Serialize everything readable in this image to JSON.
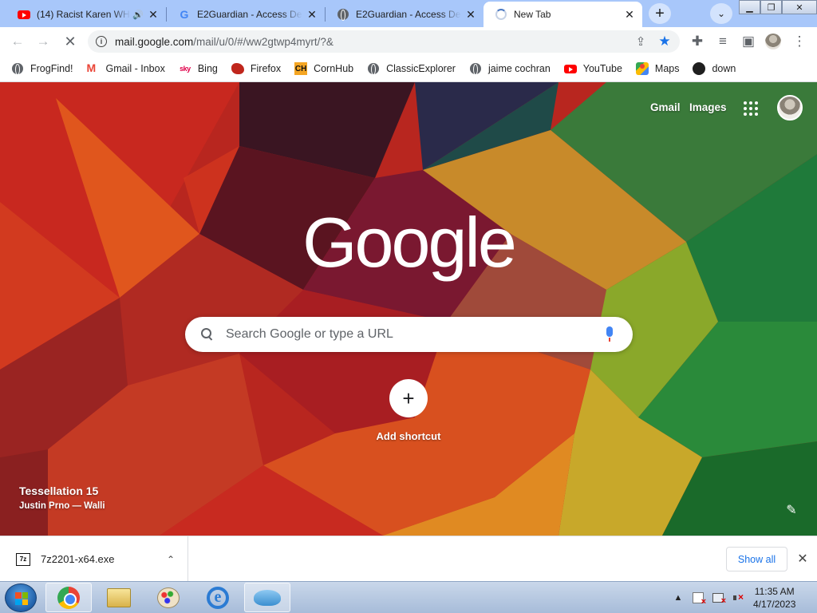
{
  "browser": {
    "tabs": [
      {
        "title": "(14) Racist Karen WH",
        "icon": "youtube-icon",
        "audio": true
      },
      {
        "title": "E2Guardian - Access Denied",
        "icon": "google-icon"
      },
      {
        "title": "E2Guardian - Access Denied",
        "icon": "globe-icon"
      },
      {
        "title": "New Tab",
        "icon": "loading-spinner-icon",
        "active": true
      }
    ],
    "new_tab_label": "+",
    "address_bar": {
      "url_host": "mail.google.com",
      "url_path": "/mail/u/0/#/ww2gtwp4myrt/?&"
    },
    "bookmarks": [
      {
        "label": "FrogFind!",
        "icon": "globe-icon"
      },
      {
        "label": "Gmail - Inbox",
        "icon": "gmail-icon"
      },
      {
        "label": "Bing",
        "icon": "sky-icon"
      },
      {
        "label": "Firefox",
        "icon": "firefox-icon"
      },
      {
        "label": "CornHub",
        "icon": "ch-icon"
      },
      {
        "label": "ClassicExplorer",
        "icon": "globe-icon"
      },
      {
        "label": "jaime cochran",
        "icon": "globe-icon"
      },
      {
        "label": "YouTube",
        "icon": "youtube-icon"
      },
      {
        "label": "Maps",
        "icon": "maps-icon"
      },
      {
        "label": "down",
        "icon": "github-icon"
      }
    ]
  },
  "ntp": {
    "links": {
      "gmail": "Gmail",
      "images": "Images"
    },
    "logo": "Google",
    "search_placeholder": "Search Google or type a URL",
    "shortcut_label": "Add shortcut",
    "background_title": "Tessellation 15",
    "background_credit": "Justin Prno — Walli",
    "colors": {
      "accent": "#1a73e8"
    }
  },
  "downloads": {
    "file_name": "7z2201-x64.exe",
    "file_icon_text": "7z",
    "show_all_label": "Show all"
  },
  "taskbar": {
    "apps": [
      "chrome-icon",
      "windows-explorer-icon",
      "paint-icon",
      "internet-explorer-icon",
      "dolphin-icon"
    ],
    "clock_time": "11:35 AM",
    "clock_date": "4/17/2023"
  }
}
